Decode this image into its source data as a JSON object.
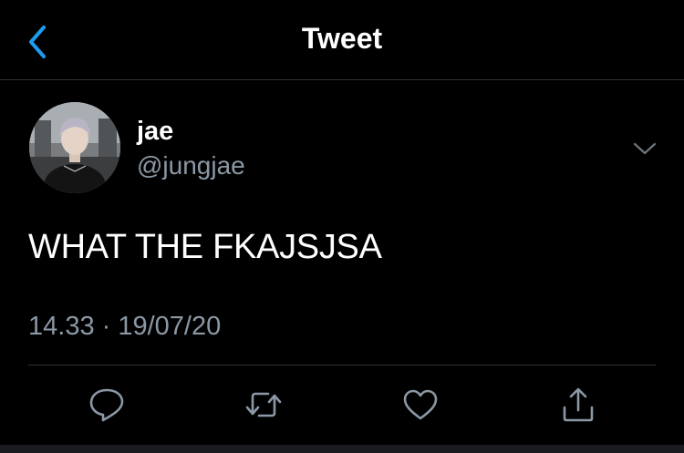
{
  "header": {
    "title": "Tweet",
    "back_icon": "chevron-left-icon"
  },
  "tweet": {
    "author": {
      "display_name": "jae",
      "handle": "@jungjae"
    },
    "text": "WHAT THE FKAJSJSA",
    "timestamp": "14.33 · 19/07/20",
    "menu_icon": "chevron-down-icon"
  },
  "actions": [
    {
      "name": "reply",
      "icon": "reply-icon"
    },
    {
      "name": "retweet",
      "icon": "retweet-icon"
    },
    {
      "name": "like",
      "icon": "heart-icon"
    },
    {
      "name": "share",
      "icon": "share-icon"
    }
  ],
  "colors": {
    "background": "#000000",
    "accent": "#1d9bf0",
    "secondary_text": "#8b98a5",
    "divider": "#2f3336"
  }
}
